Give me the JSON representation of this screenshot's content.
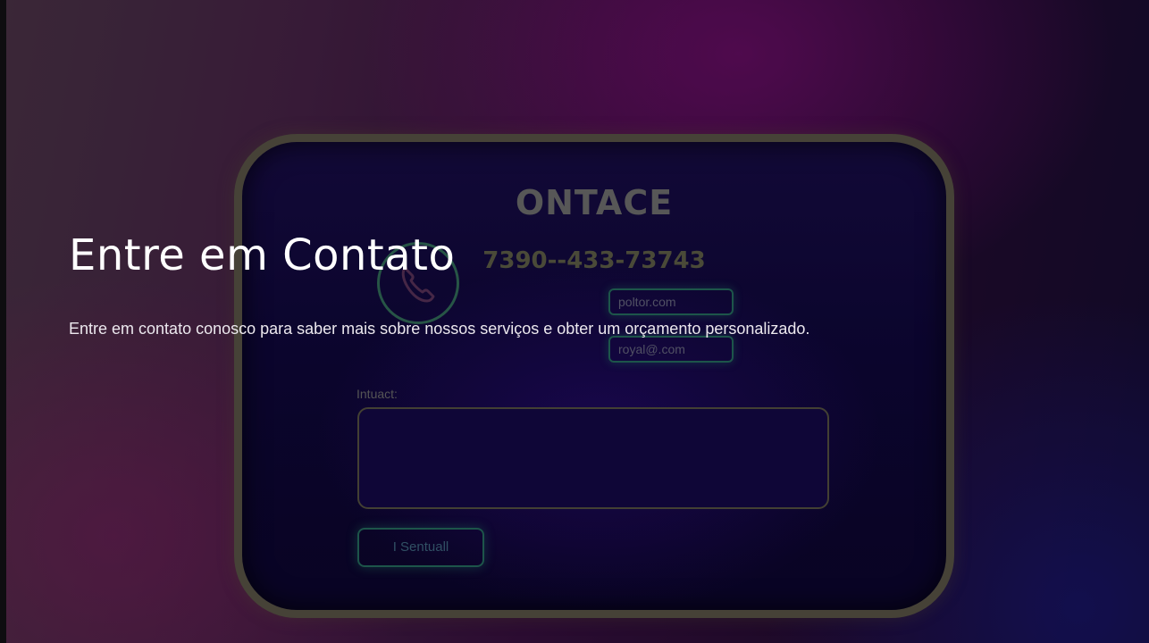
{
  "hero": {
    "title": "Entre em Contato",
    "description": "Entre em contato conosco para saber mais sobre nossos serviços e obter um orçamento personalizado."
  },
  "background_image": {
    "brand": "ONTACE",
    "phone": "7390--433-73743",
    "field_1_value": "poltor.com",
    "field_2_value": "royal@.com",
    "message_label": "Intuact:",
    "send_button": "I Sentuall",
    "icons": [
      "phone-icon"
    ]
  },
  "colors": {
    "accent_glow": "#1f5a4e",
    "title_text": "#ffffff",
    "body_text": "#ece8ee"
  }
}
